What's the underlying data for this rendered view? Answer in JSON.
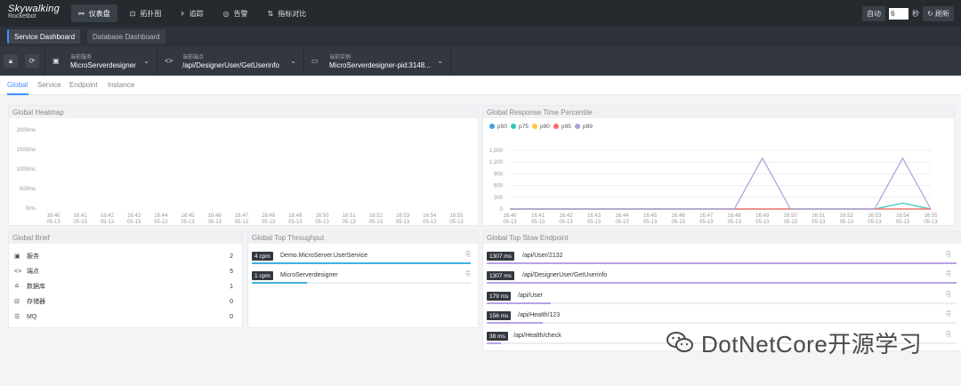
{
  "app": {
    "logo_title": "Skywalking",
    "logo_subtitle": "Rocketbot"
  },
  "nav": [
    {
      "label": "仪表盘",
      "icon": "dashboard-icon"
    },
    {
      "label": "拓扑图",
      "icon": "topology-icon"
    },
    {
      "label": "追踪",
      "icon": "trace-icon"
    },
    {
      "label": "告警",
      "icon": "alarm-icon"
    },
    {
      "label": "指标对比",
      "icon": "compare-icon"
    }
  ],
  "auto_refresh": {
    "auto_label": "自动",
    "interval": "6",
    "unit": "秒",
    "refresh_label": "刷新"
  },
  "dashboard_tabs": [
    "Service Dashboard",
    "Database Dashboard"
  ],
  "selectors": {
    "service": {
      "label": "当前服务",
      "value": "MicroServerdesigner"
    },
    "endpoint": {
      "label": "当前端点",
      "value": "/api/DesignerUser/GetUserinfo"
    },
    "instance": {
      "label": "当前实例",
      "value": "MicroServerdesigner-pid:3148..."
    }
  },
  "sub_tabs": [
    "Global",
    "Service",
    "Endpoint",
    "Instance"
  ],
  "heatmap": {
    "title": "Global Heatmap",
    "y_labels": [
      "2000ms",
      "1500ms",
      "1000ms",
      "500ms",
      "0ms"
    ],
    "x_times": [
      "16:40",
      "16:41",
      "16:42",
      "16:43",
      "16:44",
      "16:45",
      "16:46",
      "16:47",
      "16:48",
      "16:49",
      "16:50",
      "16:51",
      "16:52",
      "16:53",
      "16:54",
      "16:55"
    ],
    "x_date": "05-13"
  },
  "chart_data": {
    "type": "line",
    "title": "Global Response Time Percentile",
    "x": [
      "16:40",
      "16:41",
      "16:42",
      "16:43",
      "16:44",
      "16:45",
      "16:46",
      "16:47",
      "16:48",
      "16:49",
      "16:50",
      "16:51",
      "16:52",
      "16:53",
      "16:54",
      "16:55"
    ],
    "x_date": "05-13",
    "ylim": [
      0,
      1500
    ],
    "y_ticks": [
      0,
      300,
      600,
      900,
      1200,
      1500
    ],
    "y_tick_labels": [
      "0",
      "300",
      "600",
      "900",
      "1,200",
      "1,500"
    ],
    "legend_position": "top-left",
    "series": [
      {
        "name": "p50",
        "color": "#3fa0e5",
        "values": [
          0,
          0,
          0,
          0,
          0,
          0,
          0,
          0,
          0,
          0,
          0,
          0,
          0,
          0,
          0,
          0
        ]
      },
      {
        "name": "p75",
        "color": "#33c6b5",
        "values": [
          0,
          0,
          0,
          0,
          0,
          0,
          0,
          0,
          0,
          0,
          0,
          0,
          0,
          0,
          150,
          0
        ]
      },
      {
        "name": "p90",
        "color": "#ffc53d",
        "values": [
          0,
          0,
          0,
          0,
          0,
          0,
          0,
          0,
          0,
          0,
          0,
          0,
          0,
          0,
          0,
          0
        ]
      },
      {
        "name": "p95",
        "color": "#ff6b6b",
        "values": [
          0,
          0,
          0,
          0,
          0,
          0,
          0,
          0,
          0,
          0,
          0,
          0,
          0,
          0,
          0,
          0
        ]
      },
      {
        "name": "p99",
        "color": "#a8a1e0",
        "values": [
          0,
          0,
          0,
          0,
          0,
          0,
          0,
          0,
          0,
          1300,
          0,
          0,
          0,
          0,
          1300,
          0
        ]
      }
    ]
  },
  "brief": {
    "title": "Global Brief",
    "rows": [
      {
        "icon": "service-icon",
        "label": "服务",
        "value": "2"
      },
      {
        "icon": "endpoint-icon",
        "label": "端点",
        "value": "5"
      },
      {
        "icon": "database-icon",
        "label": "数据库",
        "value": "1"
      },
      {
        "icon": "cache-icon",
        "label": "存储器",
        "value": "0"
      },
      {
        "icon": "mq-icon",
        "label": "MQ",
        "value": "0"
      }
    ]
  },
  "throughput": {
    "title": "Global Top Throughput",
    "items": [
      {
        "badge": "4 cpm",
        "name": "Demo.MicroServer.UserService",
        "fraction": 1.0
      },
      {
        "badge": "1 cpm",
        "name": "MicroServerdesigner",
        "fraction": 0.25
      }
    ]
  },
  "slow_endpoints": {
    "title": "Global Top Slow Endpoint",
    "items": [
      {
        "badge": "1307 ms",
        "name": "/api/User/2132",
        "fraction": 1.0
      },
      {
        "badge": "1307 ms",
        "name": "/api/DesignerUser/GetUserinfo",
        "fraction": 1.0
      },
      {
        "badge": "179 ms",
        "name": "/api/User",
        "fraction": 0.137
      },
      {
        "badge": "156 ms",
        "name": "/api/Health/123",
        "fraction": 0.12
      },
      {
        "badge": "38 ms",
        "name": "/api/Health/check",
        "fraction": 0.03
      }
    ]
  },
  "watermark": {
    "text": "DotNetCore开源学习",
    "icon": "wechat-logo-icon"
  }
}
